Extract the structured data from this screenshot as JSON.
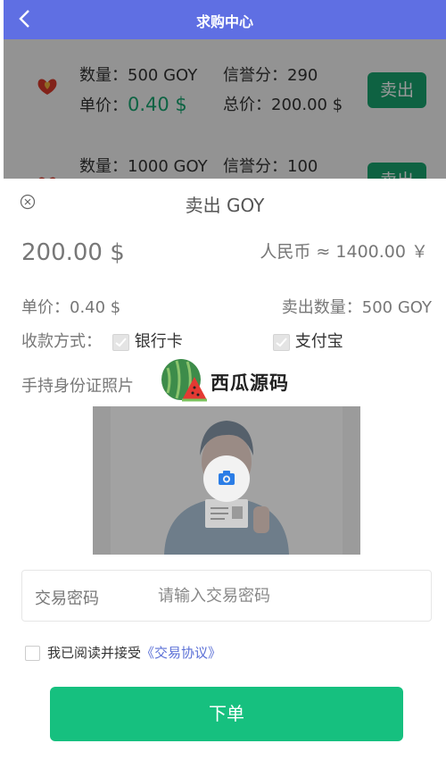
{
  "header": {
    "title": "求购中心"
  },
  "orders": [
    {
      "qty_label": "数量：",
      "qty": "500 GOY",
      "credit_label": "信誉分：",
      "credit": "290",
      "price_label": "单价：",
      "price": "0.40 $",
      "total_label": "总价：",
      "total": "200.00 $",
      "sell_label": "卖出"
    },
    {
      "qty_label": "数量：",
      "qty": "1000 GOY",
      "credit_label": "信誉分：",
      "credit": "100",
      "sell_label": "卖出"
    }
  ],
  "panel": {
    "title": "卖出 GOY",
    "amount": "200.00 $",
    "rmb": "人民币 ≈ 1400.00 ￥",
    "unit_price_label": "单价：",
    "unit_price": "0.40 $",
    "sell_qty_label": "卖出数量：",
    "sell_qty": "500 GOY",
    "payment_label": "收款方式：",
    "payment_methods": [
      {
        "label": "银行卡",
        "checked": true
      },
      {
        "label": "支付宝",
        "checked": true
      }
    ],
    "id_photo_label": "手持身份证照片",
    "watermark": "西瓜源码",
    "password_label": "交易密码",
    "password_placeholder": "请输入交易密码",
    "agree_text": "我已阅读并接受",
    "agree_link": "《交易协议》",
    "submit_label": "下单"
  },
  "colors": {
    "header": "#5f6fe3",
    "accent": "#16c07f",
    "sell": "#18a36e",
    "link": "#5a6fd6"
  }
}
